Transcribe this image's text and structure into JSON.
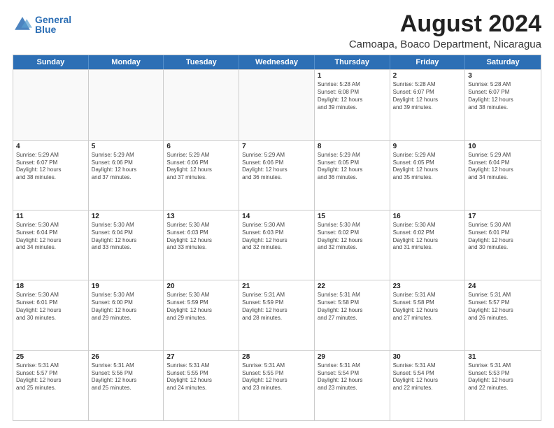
{
  "logo": {
    "line1": "General",
    "line2": "Blue"
  },
  "title": "August 2024",
  "subtitle": "Camoapa, Boaco Department, Nicaragua",
  "weekdays": [
    "Sunday",
    "Monday",
    "Tuesday",
    "Wednesday",
    "Thursday",
    "Friday",
    "Saturday"
  ],
  "weeks": [
    [
      {
        "day": "",
        "info": ""
      },
      {
        "day": "",
        "info": ""
      },
      {
        "day": "",
        "info": ""
      },
      {
        "day": "",
        "info": ""
      },
      {
        "day": "1",
        "info": "Sunrise: 5:28 AM\nSunset: 6:08 PM\nDaylight: 12 hours\nand 39 minutes."
      },
      {
        "day": "2",
        "info": "Sunrise: 5:28 AM\nSunset: 6:07 PM\nDaylight: 12 hours\nand 39 minutes."
      },
      {
        "day": "3",
        "info": "Sunrise: 5:28 AM\nSunset: 6:07 PM\nDaylight: 12 hours\nand 38 minutes."
      }
    ],
    [
      {
        "day": "4",
        "info": "Sunrise: 5:29 AM\nSunset: 6:07 PM\nDaylight: 12 hours\nand 38 minutes."
      },
      {
        "day": "5",
        "info": "Sunrise: 5:29 AM\nSunset: 6:06 PM\nDaylight: 12 hours\nand 37 minutes."
      },
      {
        "day": "6",
        "info": "Sunrise: 5:29 AM\nSunset: 6:06 PM\nDaylight: 12 hours\nand 37 minutes."
      },
      {
        "day": "7",
        "info": "Sunrise: 5:29 AM\nSunset: 6:06 PM\nDaylight: 12 hours\nand 36 minutes."
      },
      {
        "day": "8",
        "info": "Sunrise: 5:29 AM\nSunset: 6:05 PM\nDaylight: 12 hours\nand 36 minutes."
      },
      {
        "day": "9",
        "info": "Sunrise: 5:29 AM\nSunset: 6:05 PM\nDaylight: 12 hours\nand 35 minutes."
      },
      {
        "day": "10",
        "info": "Sunrise: 5:29 AM\nSunset: 6:04 PM\nDaylight: 12 hours\nand 34 minutes."
      }
    ],
    [
      {
        "day": "11",
        "info": "Sunrise: 5:30 AM\nSunset: 6:04 PM\nDaylight: 12 hours\nand 34 minutes."
      },
      {
        "day": "12",
        "info": "Sunrise: 5:30 AM\nSunset: 6:04 PM\nDaylight: 12 hours\nand 33 minutes."
      },
      {
        "day": "13",
        "info": "Sunrise: 5:30 AM\nSunset: 6:03 PM\nDaylight: 12 hours\nand 33 minutes."
      },
      {
        "day": "14",
        "info": "Sunrise: 5:30 AM\nSunset: 6:03 PM\nDaylight: 12 hours\nand 32 minutes."
      },
      {
        "day": "15",
        "info": "Sunrise: 5:30 AM\nSunset: 6:02 PM\nDaylight: 12 hours\nand 32 minutes."
      },
      {
        "day": "16",
        "info": "Sunrise: 5:30 AM\nSunset: 6:02 PM\nDaylight: 12 hours\nand 31 minutes."
      },
      {
        "day": "17",
        "info": "Sunrise: 5:30 AM\nSunset: 6:01 PM\nDaylight: 12 hours\nand 30 minutes."
      }
    ],
    [
      {
        "day": "18",
        "info": "Sunrise: 5:30 AM\nSunset: 6:01 PM\nDaylight: 12 hours\nand 30 minutes."
      },
      {
        "day": "19",
        "info": "Sunrise: 5:30 AM\nSunset: 6:00 PM\nDaylight: 12 hours\nand 29 minutes."
      },
      {
        "day": "20",
        "info": "Sunrise: 5:30 AM\nSunset: 5:59 PM\nDaylight: 12 hours\nand 29 minutes."
      },
      {
        "day": "21",
        "info": "Sunrise: 5:31 AM\nSunset: 5:59 PM\nDaylight: 12 hours\nand 28 minutes."
      },
      {
        "day": "22",
        "info": "Sunrise: 5:31 AM\nSunset: 5:58 PM\nDaylight: 12 hours\nand 27 minutes."
      },
      {
        "day": "23",
        "info": "Sunrise: 5:31 AM\nSunset: 5:58 PM\nDaylight: 12 hours\nand 27 minutes."
      },
      {
        "day": "24",
        "info": "Sunrise: 5:31 AM\nSunset: 5:57 PM\nDaylight: 12 hours\nand 26 minutes."
      }
    ],
    [
      {
        "day": "25",
        "info": "Sunrise: 5:31 AM\nSunset: 5:57 PM\nDaylight: 12 hours\nand 25 minutes."
      },
      {
        "day": "26",
        "info": "Sunrise: 5:31 AM\nSunset: 5:56 PM\nDaylight: 12 hours\nand 25 minutes."
      },
      {
        "day": "27",
        "info": "Sunrise: 5:31 AM\nSunset: 5:55 PM\nDaylight: 12 hours\nand 24 minutes."
      },
      {
        "day": "28",
        "info": "Sunrise: 5:31 AM\nSunset: 5:55 PM\nDaylight: 12 hours\nand 23 minutes."
      },
      {
        "day": "29",
        "info": "Sunrise: 5:31 AM\nSunset: 5:54 PM\nDaylight: 12 hours\nand 23 minutes."
      },
      {
        "day": "30",
        "info": "Sunrise: 5:31 AM\nSunset: 5:54 PM\nDaylight: 12 hours\nand 22 minutes."
      },
      {
        "day": "31",
        "info": "Sunrise: 5:31 AM\nSunset: 5:53 PM\nDaylight: 12 hours\nand 22 minutes."
      }
    ]
  ]
}
